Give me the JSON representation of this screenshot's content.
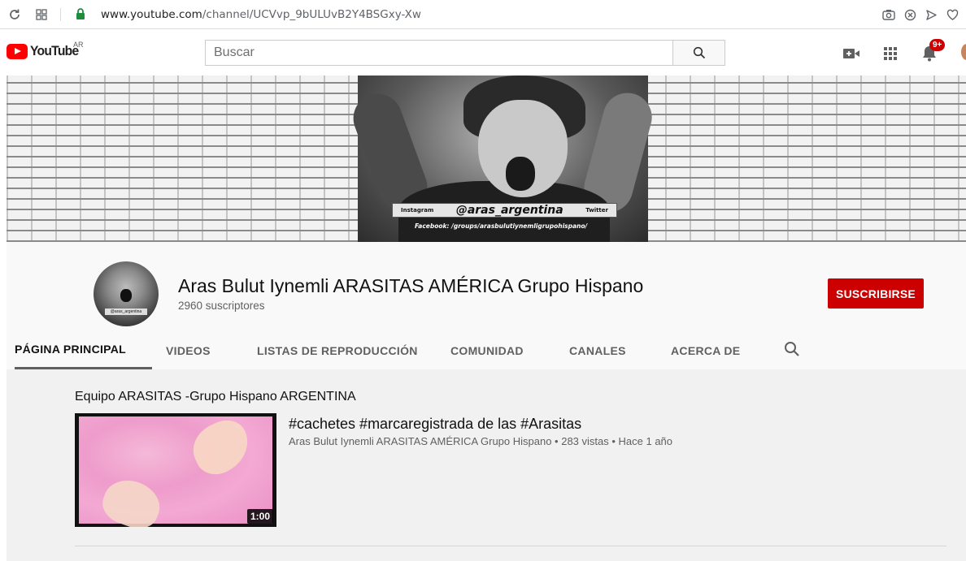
{
  "browser": {
    "url_host": "www.youtube.com",
    "url_path": "/channel/UCVvp_9bULUvB2Y4BSGxy-Xw",
    "icons": [
      "reload-icon",
      "apps-grid-icon",
      "lock-icon",
      "camera-icon",
      "block-icon",
      "send-icon",
      "heart-icon"
    ],
    "lock_color": "#1e8e3e"
  },
  "header": {
    "logo_text": "YouTube",
    "country_code": "AR",
    "search_placeholder": "Buscar",
    "notification_count": "9+",
    "brand_color": "#ff0000"
  },
  "banner": {
    "left_label": "Instagram",
    "handle": "@aras_argentina",
    "right_label": "Twitter",
    "facebook_line": "Facebook: /groups/arasbulutiynemligrupohispano/"
  },
  "channel": {
    "avatar_label": "@aras_argentina",
    "name": "Aras Bulut Iynemli ARASITAS AMÉRICA Grupo Hispano",
    "subscribers": "2960 suscriptores",
    "subscribe_label": "SUSCRIBIRSE",
    "subscribe_color": "#cc0000"
  },
  "tabs": [
    {
      "label": "PÁGINA PRINCIPAL",
      "active": true
    },
    {
      "label": "VIDEOS",
      "active": false
    },
    {
      "label": "LISTAS DE REPRODUCCIÓN",
      "active": false
    },
    {
      "label": "COMUNIDAD",
      "active": false
    },
    {
      "label": "CANALES",
      "active": false
    },
    {
      "label": "ACERCA DE",
      "active": false
    }
  ],
  "shelf": {
    "title": "Equipo ARASITAS -Grupo Hispano ARGENTINA",
    "video": {
      "title": "#cachetes #marcaregistrada de las #Arasitas",
      "meta": "Aras Bulut Iynemli ARASITAS AMÉRICA Grupo Hispano • 283 vistas • Hace 1 año",
      "duration": "1:00"
    }
  }
}
